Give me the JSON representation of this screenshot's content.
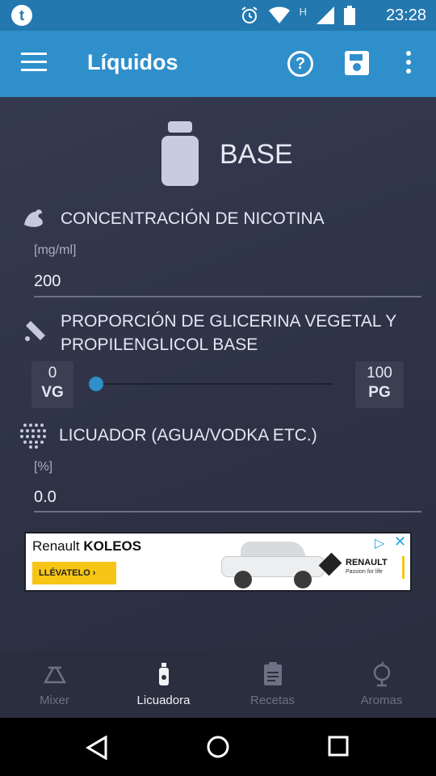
{
  "status_bar": {
    "time": "23:28",
    "network_label": "H",
    "icons": [
      "app-notification-icon",
      "alarm-icon",
      "wifi-icon",
      "network-h-icon",
      "signal-icon",
      "battery-icon"
    ]
  },
  "app_bar": {
    "title": "Líquidos",
    "icons": [
      "menu-icon",
      "help-icon",
      "save-icon",
      "more-icon"
    ]
  },
  "base": {
    "label": "BASE"
  },
  "nicotine": {
    "title": "CONCENTRACIÓN DE NICOTINA",
    "unit": "[mg/ml]",
    "value": "200"
  },
  "ratio": {
    "title_line1": "PROPORCIÓN DE GLICERINA VEGETAL Y",
    "title_line2": "PROPILENGLICOL BASE",
    "vg_value": "0",
    "vg_label": "VG",
    "pg_value": "100",
    "pg_label": "PG",
    "slider_fraction": 0.0
  },
  "diluent": {
    "title": "LICUADOR (AGUA/VODKA ETC.)",
    "unit": "[%]",
    "value": "0.0"
  },
  "ad": {
    "brand_prefix": "Renault ",
    "brand_model": "KOLEOS",
    "cta": "LLÉVATELO  ›",
    "logo_text": "RENAULT",
    "tagline": "Passion for life",
    "adchoice_symbol": "▷",
    "close_symbol": "✕"
  },
  "bottom_nav": {
    "items": [
      {
        "label": "Mixer",
        "icon": "mixer-icon",
        "active": false
      },
      {
        "label": "Licuadora",
        "icon": "bottle-icon",
        "active": true
      },
      {
        "label": "Recetas",
        "icon": "clipboard-icon",
        "active": false
      },
      {
        "label": "Aromas",
        "icon": "flask-icon",
        "active": false
      }
    ]
  },
  "system_nav": {
    "icons": [
      "back-icon",
      "home-icon",
      "recents-icon"
    ]
  },
  "colors": {
    "primary": "#2f8fcb",
    "status_bar": "#2378b0",
    "background": "#2e3346",
    "nav_background": "#2a2e3e"
  }
}
